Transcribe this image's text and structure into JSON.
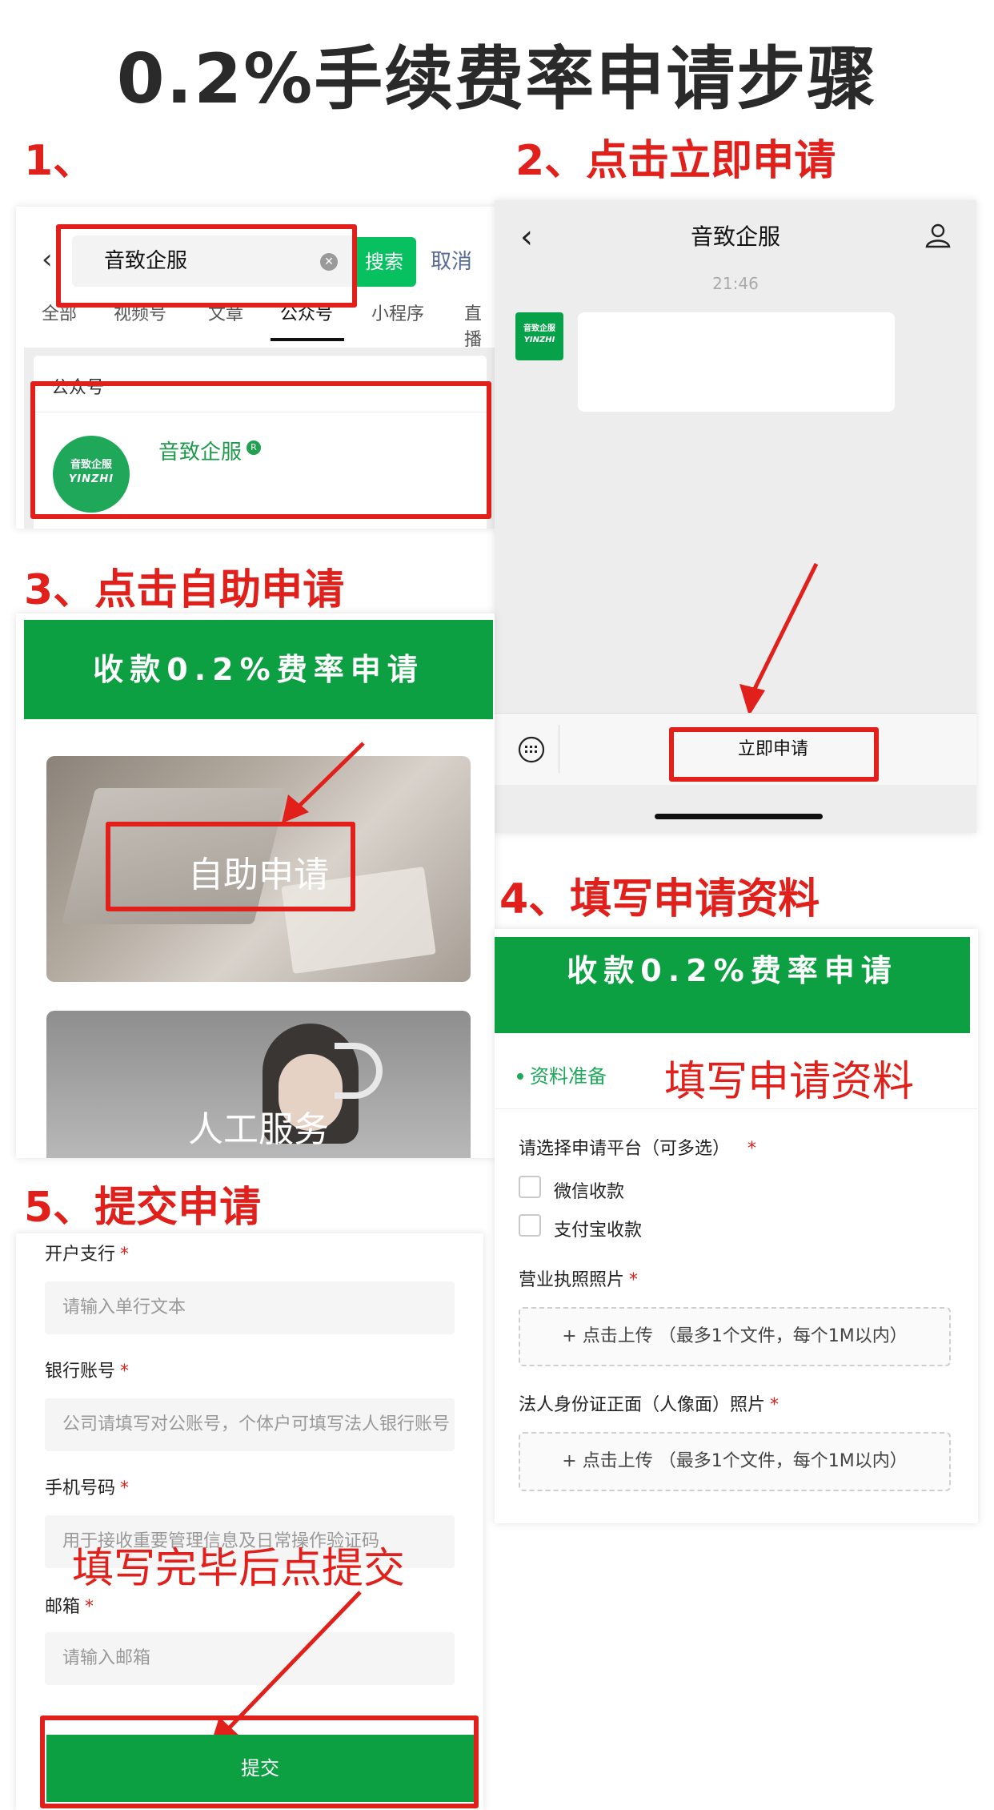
{
  "page_title": "0.2%手续费率申请步骤",
  "steps": {
    "s1": "1、",
    "s2": "2、点击立即申请",
    "s3": "3、点击自助申请",
    "s4": "4、填写申请资料",
    "s5": "5、提交申请"
  },
  "search_screen": {
    "back": "‹",
    "query": "音致企服",
    "search_button": "搜索",
    "cancel": "取消",
    "tabs": [
      "全部",
      "视频号",
      "文章",
      "公众号",
      "小程序",
      "直播"
    ],
    "section_label": "公众号",
    "result_name": "音致企服",
    "verified_badge": "R",
    "logo_line1": "音致企服",
    "logo_line2": "YINZHI"
  },
  "chat_screen": {
    "title": "音致企服",
    "time": "21:46",
    "avatar_line1": "音致企服",
    "avatar_line2": "YINZHI",
    "menu_button": "立即申请"
  },
  "service_screen": {
    "banner": "收款0.2%费率申请",
    "self_service": "自助申请",
    "human_service": "人工服务"
  },
  "form_screen": {
    "banner": "收款0.2%费率申请",
    "section": "资料准备",
    "annotation": "填写申请资料",
    "platform_label": "请选择申请平台（可多选）",
    "options": [
      "微信收款",
      "支付宝收款"
    ],
    "license_label": "营业执照照片",
    "upload_text": "+ 点击上传 （最多1个文件，每个1M以内）",
    "id_label": "法人身份证正面（人像面）照片"
  },
  "submit_screen": {
    "bank_branch_label": "开户支行",
    "bank_branch_placeholder": "请输入单行文本",
    "account_label": "银行账号",
    "account_placeholder": "公司请填写对公账号，个体户可填写法人银行账号",
    "phone_label": "手机号码",
    "phone_placeholder": "用于接收重要管理信息及日常操作验证码",
    "email_label": "邮箱",
    "email_placeholder": "请输入邮箱",
    "annotation": "填写完毕后点提交",
    "submit": "提交",
    "required_mark": "*"
  },
  "colors": {
    "accent_red": "#e2201b",
    "wechat_green": "#07c160",
    "banner_green": "#0ca043"
  }
}
